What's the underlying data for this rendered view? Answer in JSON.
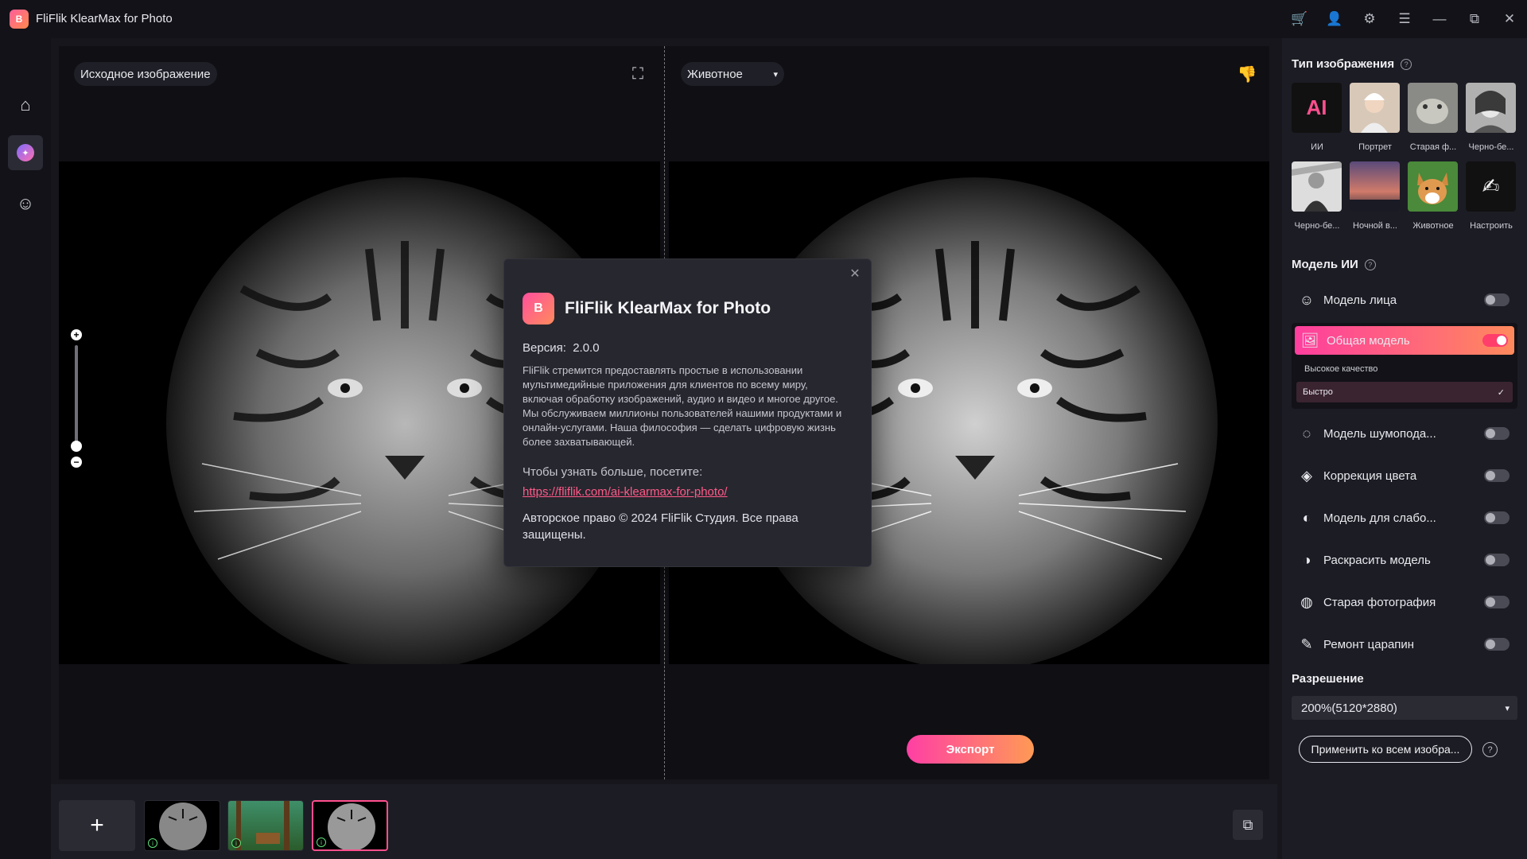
{
  "app": {
    "title": "FliFlik KlearMax for Photo",
    "logo_text": "B"
  },
  "window_controls": {
    "cart": "cart-icon",
    "account": "user-icon",
    "settings": "gear-icon",
    "menu": "menu-icon",
    "minimize": "minimize-icon",
    "maximize": "maximize-icon",
    "close": "close-icon"
  },
  "rail": {
    "items": [
      "home-icon",
      "enhance-icon",
      "face-icon"
    ]
  },
  "editor": {
    "source_label": "Исходное изображение",
    "image_type_selected": "Животное",
    "export_label": "Экспорт",
    "zoom": {
      "plus": "+",
      "minus": "−",
      "level": 0.05
    }
  },
  "about": {
    "title": "FliFlik KlearMax for Photo",
    "logo_text": "B",
    "version_label": "Версия:",
    "version": "2.0.0",
    "description": "FliFlik стремится предоставлять простые в использовании мультимедийные приложения для клиентов по всему миру, включая обработку изображений, аудио и видео и многое другое. Мы обслуживаем миллионы пользователей нашими продуктами и онлайн-услугами. Наша философия — сделать цифровую жизнь более захватывающей.",
    "learn_more": "Чтобы узнать больше, посетите:",
    "link": "https://fliflik.com/ai-klearmax-for-photo/",
    "copyright": "Авторское право © 2024 FliFlik Студия. Все права защищены."
  },
  "tray": {
    "add_label": "+",
    "thumbs": [
      "tiger",
      "forest",
      "tiger"
    ],
    "selected_index": 2
  },
  "panel": {
    "image_type_title": "Тип изображения",
    "types": [
      {
        "label": "ИИ",
        "glyph": "AI"
      },
      {
        "label": "Портрет"
      },
      {
        "label": "Старая ф..."
      },
      {
        "label": "Черно-бе..."
      },
      {
        "label": "Черно-бе..."
      },
      {
        "label": "Ночной в..."
      },
      {
        "label": "Животное"
      },
      {
        "label": "Настроить",
        "glyph": "✍"
      }
    ],
    "ai_model_title": "Модель ИИ",
    "models": [
      {
        "label": "Модель лица",
        "icon": "face-smile-icon",
        "on": false
      },
      {
        "label": "Общая модель",
        "icon": "image-icon",
        "on": true
      },
      {
        "label": "Модель шумопода...",
        "icon": "denoise-icon",
        "on": false
      },
      {
        "label": "Коррекция цвета",
        "icon": "paint-bucket-icon",
        "on": false
      },
      {
        "label": "Модель для слабо...",
        "icon": "contrast-icon",
        "on": false
      },
      {
        "label": "Раскрасить модель",
        "icon": "colorize-icon",
        "on": false
      },
      {
        "label": "Старая фотография",
        "icon": "old-photo-icon",
        "on": false
      },
      {
        "label": "Ремонт царапин",
        "icon": "brush-icon",
        "on": false
      }
    ],
    "quality_label": "Высокое качество",
    "quality_option": "Быстро",
    "resolution_title": "Разрешение",
    "resolution_value": "200%(5120*2880)",
    "apply_all": "Применить ко всем изобра..."
  }
}
